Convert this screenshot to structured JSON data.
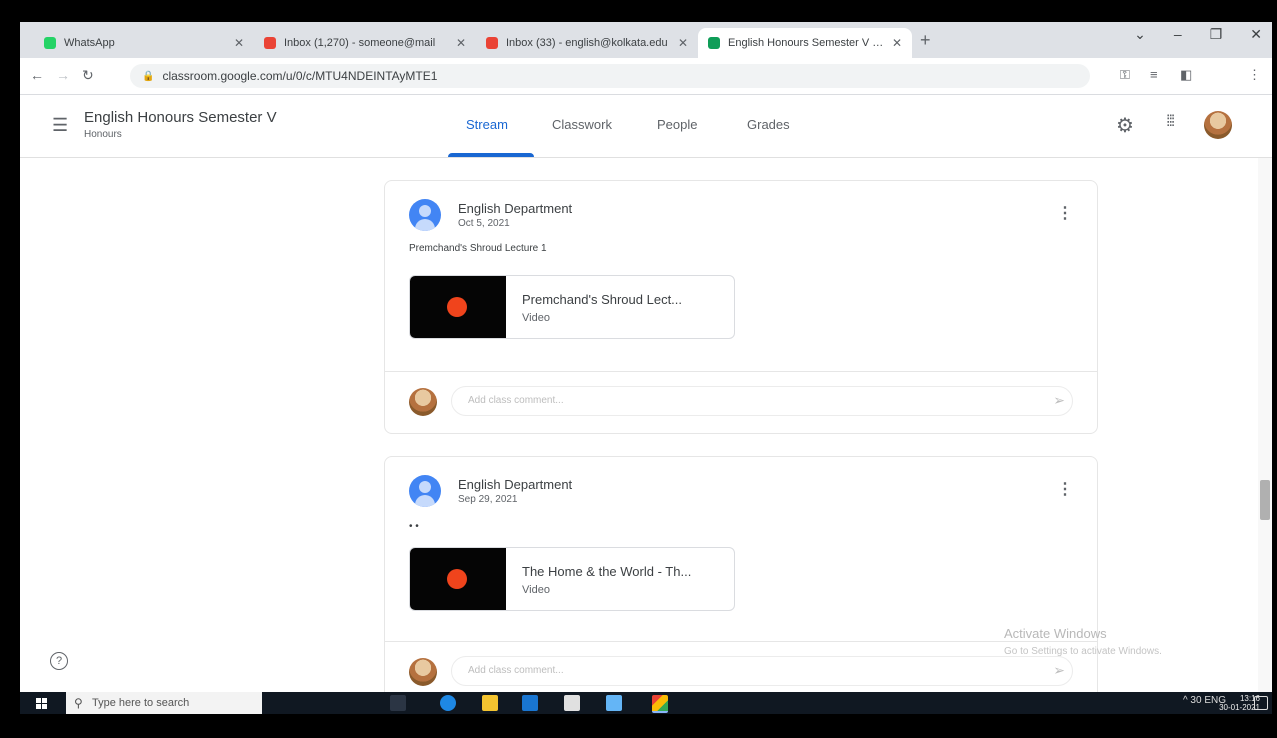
{
  "browser": {
    "tabs": [
      {
        "title": "WhatsApp",
        "active": false,
        "color": "#25d366"
      },
      {
        "title": "Inbox (1,270) - someone@mail",
        "active": false,
        "color": "#ea4335"
      },
      {
        "title": "Inbox (33) - english@kolkata.edu",
        "active": false,
        "color": "#ea4335"
      },
      {
        "title": "English Honours Semester V (Ku",
        "active": true,
        "color": "#0f9d58"
      }
    ],
    "url": "classroom.google.com/u/0/c/MTU4NDEINTAyMTE1"
  },
  "classroom": {
    "class_title": "English Honours Semester V",
    "class_subtitle": "Honours",
    "tabs": [
      "Stream",
      "Classwork",
      "People",
      "Grades"
    ],
    "active_tab": "Stream"
  },
  "posts": [
    {
      "author": "English Department",
      "date": "Oct 5, 2021",
      "text": "Premchand's Shroud Lecture 1",
      "attachment": {
        "title": "Premchand's Shroud Lect...",
        "type": "Video"
      },
      "comment_placeholder": "Add class comment..."
    },
    {
      "author": "English Department",
      "date": "Sep 29, 2021",
      "text": "• •",
      "attachment": {
        "title": "The Home & the World - Th...",
        "type": "Video"
      },
      "comment_placeholder": "Add class comment..."
    }
  ],
  "watermark": {
    "title": "Activate Windows",
    "subtitle": "Go to Settings to activate Windows."
  },
  "taskbar": {
    "search_placeholder": "Type here to search",
    "tray_text": "^ 30 ENG",
    "time": "13:16",
    "date": "30-01-2021"
  },
  "colors": {
    "accent": "#1967d2",
    "taskbar": "#101822",
    "play": "#f0441c"
  }
}
